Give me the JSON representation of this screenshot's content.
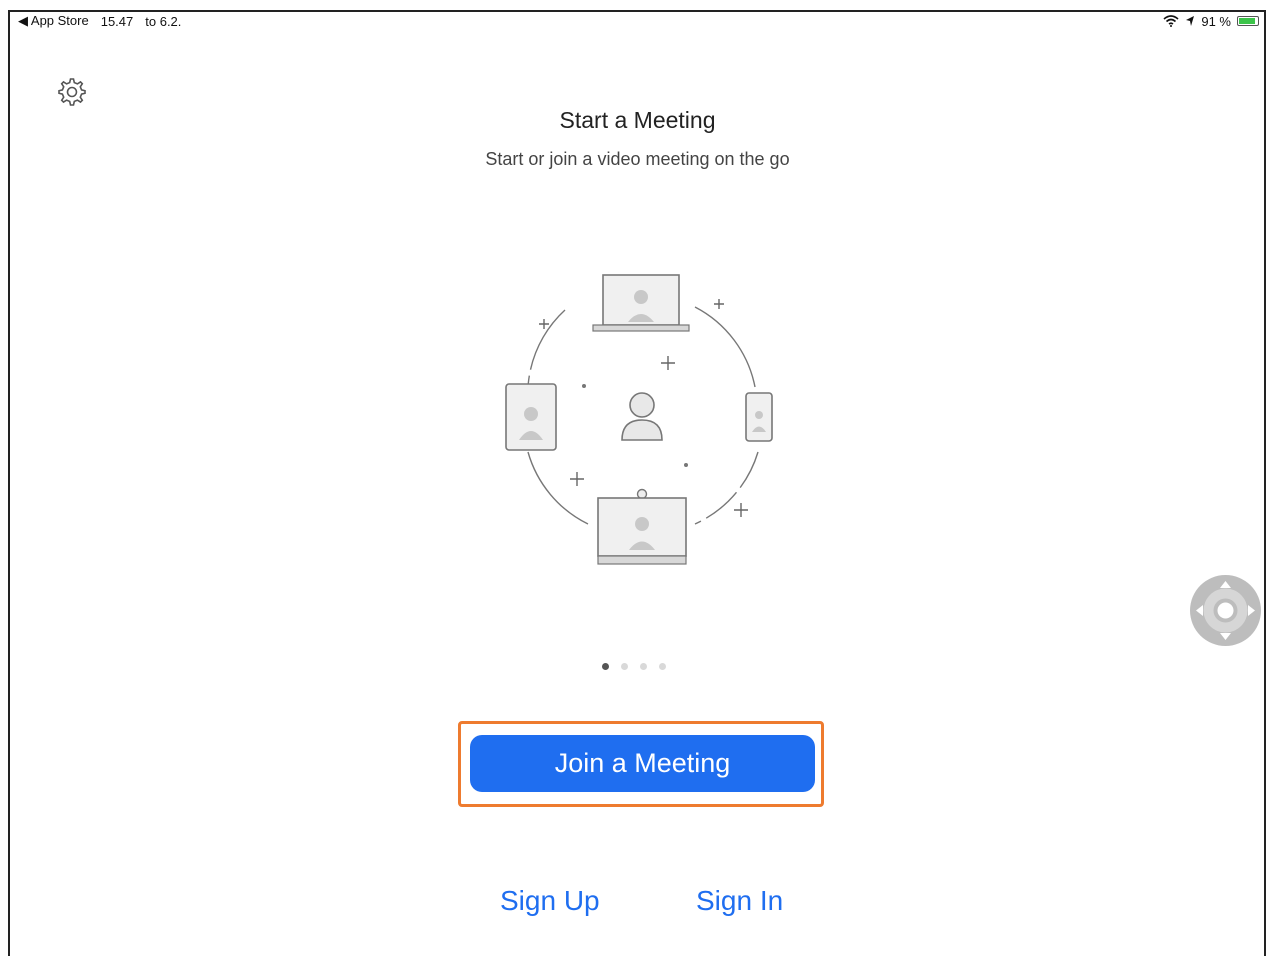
{
  "status_bar": {
    "back_label": "◀ App Store",
    "time": "15.47",
    "date": "to 6.2.",
    "battery": "91 %"
  },
  "welcome": {
    "title": "Start a Meeting",
    "subtitle": "Start or join a video meeting on the go"
  },
  "pager": {
    "count": 4,
    "active_index": 0
  },
  "actions": {
    "join": "Join a Meeting",
    "sign_up": "Sign Up",
    "sign_in": "Sign In"
  },
  "colors": {
    "accent": "#1f6ef0",
    "highlight": "#ee7b2f",
    "battery": "#3cc44a"
  },
  "icons": {
    "settings": "gear-icon",
    "wifi": "wifi-icon",
    "location": "location-icon",
    "assistive_touch": "assistive-touch-icon"
  }
}
